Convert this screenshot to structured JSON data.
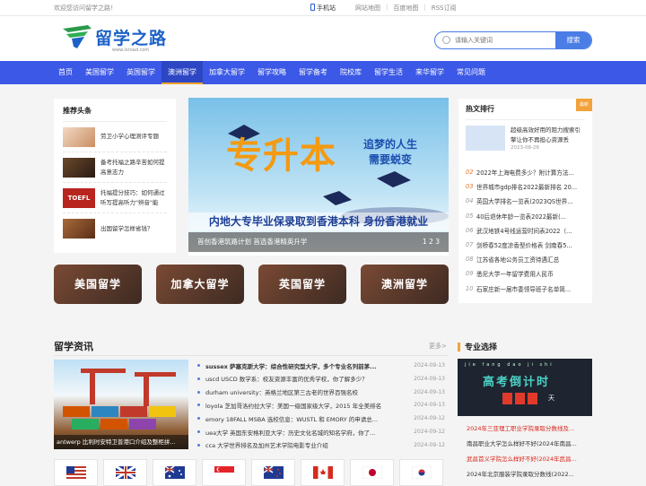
{
  "topbar": {
    "welcome": "欢迎您访问留学之路！",
    "mobile": "手机站",
    "links": [
      "网站地图",
      "百度地图",
      "RSS订阅"
    ]
  },
  "logo": {
    "name": "留学之路",
    "url": "www.lxroad.com"
  },
  "search": {
    "placeholder": "请输入关键词",
    "button": "搜索"
  },
  "nav": {
    "items": [
      "首页",
      "美国留学",
      "英国留学",
      "澳洲留学",
      "加拿大留学",
      "留学攻略",
      "留学备考",
      "院校库",
      "留学生活",
      "来华留学",
      "常见问题"
    ],
    "active_index": 3
  },
  "headlines": {
    "title": "推荐头条",
    "items": [
      "劳卫小学心理测评专题",
      "备考托福之路辛苦如何提高意志力",
      "托福提分技巧：如何通过听写提高听力\"辨音\"能",
      "出国留学怎样省钱？"
    ]
  },
  "banner": {
    "headline": "专升本",
    "slogan_line1": "追梦的人生",
    "slogan_line2": "需要蜕变",
    "strip": "内地大专毕业保录取到香港本科 身份香港就业",
    "caption": "首创香港筑路计划 首选香港精英升学",
    "caption_right": "1 2 3"
  },
  "tiles": [
    "美国留学",
    "加拿大留学",
    "英国留学",
    "澳洲留学"
  ],
  "ranking": {
    "title": "热文排行",
    "badge": "最新",
    "top": {
      "title": "超级高效好用的阻力搜索引擎让你不再担心资源丢",
      "date": "2023-08-26"
    },
    "items": [
      {
        "n": "02",
        "t": "2022年上海电费多少？附计算方法..."
      },
      {
        "n": "03",
        "t": "世界城市gdp排名2022最新排名 20..."
      },
      {
        "n": "04",
        "t": "英国大学排名一览表(2023QS世界..."
      },
      {
        "n": "05",
        "t": "40后退休年龄一览表2022最新(..."
      },
      {
        "n": "06",
        "t": "武汉地铁4号线运营时间表2022（..."
      },
      {
        "n": "07",
        "t": "剑桥春52度凉香型价格表 剑南春5..."
      },
      {
        "n": "08",
        "t": "江苏省各地公务员工资待遇汇总"
      },
      {
        "n": "09",
        "t": "悉尼大学一年留学费用人民币"
      },
      {
        "n": "10",
        "t": "石家庄新一届市委领导班子名单简..."
      }
    ]
  },
  "news": {
    "title": "留学资讯",
    "more": "更多>",
    "image_caption": "antwerp 比利时安特卫普港口介绍及整柜拼...",
    "items": [
      {
        "t": "sussex 萨塞克斯大学：综合性研究型大学，多个专业名列前茅...",
        "d": "2024-09-13",
        "bold": true
      },
      {
        "t": "uscd USCD 数学系：校友资源丰富的优秀学校，你了解多少？",
        "d": "2024-09-13"
      },
      {
        "t": "durham university：英格兰地区第三古老的世界百强名校",
        "d": "2024-09-13"
      },
      {
        "t": "loyola 芝加哥洛约拉大学：美国一级国家级大学，2015 年全美排名",
        "d": "2024-09-13"
      },
      {
        "t": "emory 18FALL MSBA 选校信息：WUSTL 和 EMORY 的申请总...",
        "d": "2024-09-12"
      },
      {
        "t": "uea大学 英国东安格利亚大学：历史文化名城的知名学府，你了...",
        "d": "2024-09-12"
      },
      {
        "t": "cca 大学世界排名及加州艺术学院电影专业介绍",
        "d": "2024-09-12"
      }
    ]
  },
  "flags": [
    "us-flag",
    "uk-flag",
    "australia-flag",
    "singapore-flag",
    "new-zealand-flag",
    "canada-flag",
    "japan-flag",
    "korea-flag"
  ],
  "major": {
    "title": "专业选择",
    "img_pinyin": "jie fang dao ji shi",
    "img_title": "高考倒计时",
    "img_day": "天",
    "items": [
      {
        "t": "2024年三亚理工职业学院录取分数线及...",
        "red": true
      },
      {
        "t": "南昌职业大学怎么样好不好(2024年南昌...",
        "red": false
      },
      {
        "t": "武昌首义学院怎么样好不好(2024年武昌...",
        "red": true
      },
      {
        "t": "2024年北京服装学院录取分数线(2022...",
        "red": false
      }
    ]
  },
  "colors": {
    "brand": "#3c58e6",
    "accent": "#f2a23a",
    "link_red": "#d9251a"
  }
}
